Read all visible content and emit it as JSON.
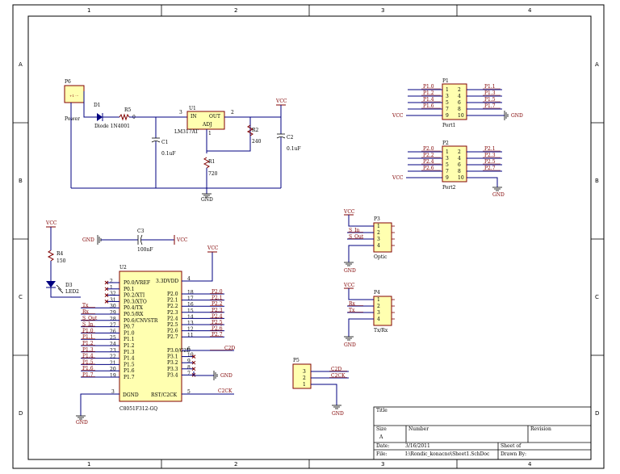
{
  "frame": {
    "columns": [
      "1",
      "2",
      "3",
      "4"
    ],
    "rows": [
      "A",
      "B",
      "C",
      "D"
    ]
  },
  "title_block": {
    "title_label": "Title",
    "size_label": "Size",
    "size_value": "A",
    "number_label": "Number",
    "revision_label": "Revision",
    "date_label": "Date:",
    "date_value": "3/16/2011",
    "file_label": "File:",
    "file_value": "I:\\Rondic_konacno\\Sheet1.SchDoc",
    "sheet_label": "Sheet    of",
    "drawn_label": "Drawn By:"
  },
  "power_section": {
    "p6": {
      "ref": "P6",
      "name": "Power"
    },
    "d1": {
      "ref": "D1",
      "name": "Diode 1N4001"
    },
    "r5": {
      "ref": "R5",
      "value": "0"
    },
    "c1": {
      "ref": "C1",
      "value": "0.1uF"
    },
    "u1": {
      "ref": "U1",
      "name": "LM317AT",
      "pin_in": "IN",
      "pin_out": "OUT",
      "pin_adj": "ADJ",
      "pin3": "3",
      "pin2": "2",
      "pin1": "1"
    },
    "r2": {
      "ref": "R2",
      "value": "240"
    },
    "r1": {
      "ref": "R1",
      "value": "720"
    },
    "c2": {
      "ref": "C2",
      "value": "0.1uF"
    },
    "vcc": "VCC",
    "gnd": "GND"
  },
  "ports": {
    "p1": {
      "ref": "P1",
      "name": "Port1",
      "left": [
        "P1.0",
        "P1.2",
        "P1.4",
        "P1.6"
      ],
      "right": [
        "P1.1",
        "P1.3",
        "P1.5",
        "P1.7"
      ],
      "pins_left": [
        "1",
        "3",
        "5",
        "7",
        "9"
      ],
      "pins_right": [
        "2",
        "4",
        "6",
        "8",
        "10"
      ],
      "vcc": "VCC",
      "gnd": "GND"
    },
    "p2": {
      "ref": "P2",
      "name": "Port2",
      "left": [
        "P2.0",
        "P2.2",
        "P2.4",
        "P2.6"
      ],
      "right": [
        "P2.1",
        "P2.3",
        "P2.5",
        "P2.7"
      ],
      "pins_left": [
        "1",
        "3",
        "5",
        "7",
        "9"
      ],
      "pins_right": [
        "2",
        "4",
        "6",
        "8",
        "10"
      ],
      "vcc": "VCC",
      "gnd": "GND"
    }
  },
  "led_section": {
    "vcc": "VCC",
    "r4": {
      "ref": "R4",
      "value": "150"
    },
    "d3": {
      "ref": "D3",
      "name": "LED2"
    }
  },
  "cap_section": {
    "c3": {
      "ref": "C3",
      "value": "100nF"
    },
    "gnd": "GND",
    "vcc": "VCC"
  },
  "mcu": {
    "ref": "U2",
    "name": "C8051F312-GQ",
    "vcc": "VCC",
    "gnd": "GND",
    "pins_left": [
      {
        "num": "2",
        "name": "P0.0/VREF",
        "net": ""
      },
      {
        "num": "1",
        "name": "P0.1",
        "net": ""
      },
      {
        "num": "32",
        "name": "P0.2/XTI",
        "net": ""
      },
      {
        "num": "31",
        "name": "P0.3/XTO",
        "net": ""
      },
      {
        "num": "30",
        "name": "P0.4/TX",
        "net": "Tx"
      },
      {
        "num": "29",
        "name": "P0.5/RX",
        "net": "Rx"
      },
      {
        "num": "28",
        "name": "P0.6/CNVSTR",
        "net": "S_Out"
      },
      {
        "num": "27",
        "name": "P0.7",
        "net": "S_In"
      },
      {
        "num": "26",
        "name": "P1.0",
        "net": "P1.0"
      },
      {
        "num": "25",
        "name": "P1.1",
        "net": "P1.1"
      },
      {
        "num": "24",
        "name": "P1.2",
        "net": "P1.2"
      },
      {
        "num": "23",
        "name": "P1.3",
        "net": "P1.3"
      },
      {
        "num": "22",
        "name": "P1.4",
        "net": "P1.4"
      },
      {
        "num": "21",
        "name": "P1.5",
        "net": "P1.5"
      },
      {
        "num": "20",
        "name": "P1.6",
        "net": "P1.6"
      },
      {
        "num": "19",
        "name": "P1.7",
        "net": "P1.7"
      }
    ],
    "pins_right": [
      {
        "num": "18",
        "name": "P2.0",
        "net": "P2.0"
      },
      {
        "num": "17",
        "name": "P2.1",
        "net": "P2.1"
      },
      {
        "num": "16",
        "name": "P2.2",
        "net": "P2.2"
      },
      {
        "num": "15",
        "name": "P2.3",
        "net": "P2.3"
      },
      {
        "num": "14",
        "name": "P2.4",
        "net": "P2.4"
      },
      {
        "num": "13",
        "name": "P2.5",
        "net": "P2.5"
      },
      {
        "num": "12",
        "name": "P2.6",
        "net": "P2.6"
      },
      {
        "num": "11",
        "name": "P2.7",
        "net": "P2.7"
      },
      {
        "num": "6",
        "name": "P3.0/C2D",
        "net": "C2D"
      },
      {
        "num": "10",
        "name": "P3.1",
        "net": ""
      },
      {
        "num": "9",
        "name": "P3.2",
        "net": ""
      },
      {
        "num": "8",
        "name": "P3.3",
        "net": ""
      },
      {
        "num": "7",
        "name": "P3.4",
        "net": ""
      }
    ],
    "pin_3dvdd": {
      "num": "4",
      "name": "3.3DVDD"
    },
    "pin_dgnd": {
      "num": "3",
      "name": "DGND"
    },
    "pin_rst": {
      "num": "5",
      "name": "RST/C2CK",
      "net": "C2CK"
    }
  },
  "p3": {
    "ref": "P3",
    "name": "Optic",
    "nets": [
      "S_In",
      "S_Out"
    ],
    "pins": [
      "1",
      "2",
      "3",
      "4"
    ],
    "vcc": "VCC",
    "gnd": "GND"
  },
  "p4": {
    "ref": "P4",
    "name": "Tx/Rx",
    "nets": [
      "Rx",
      "Tx"
    ],
    "pins": [
      "1",
      "2",
      "3",
      "4"
    ],
    "vcc": "VCC",
    "gnd": "GND"
  },
  "p5": {
    "ref": "P5",
    "nets": [
      "C2D",
      "C2CK"
    ],
    "pins": [
      "3",
      "2",
      "1"
    ],
    "gnd": "GND"
  }
}
